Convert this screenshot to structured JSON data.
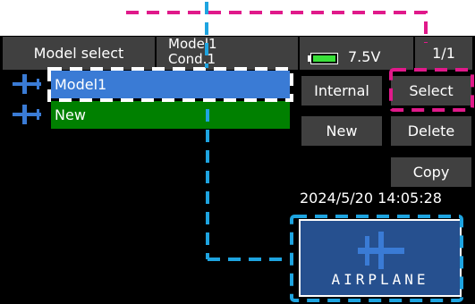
{
  "header": {
    "model_select": "Model select",
    "model_name": "Model1",
    "condition": "Cond.1",
    "battery_voltage": "7.5V",
    "page": "1/1"
  },
  "model_list": [
    {
      "label": "Model1",
      "icon": "airplane-icon",
      "row_color": "#3a7bd5"
    },
    {
      "label": "New",
      "icon": "airplane-icon",
      "row_color": "#008000"
    }
  ],
  "buttons": {
    "internal": "Internal",
    "select": "Select",
    "new": "New",
    "delete": "Delete",
    "copy": "Copy"
  },
  "datetime": "2024/5/20 14:05:28",
  "model_type": {
    "label": "AIRPLANE",
    "icon": "airplane-icon"
  },
  "colors": {
    "header_bg": "#404040",
    "selected_row": "#3a7bd5",
    "new_row": "#008000",
    "model_type_bg": "#26508f",
    "battery": "#39e039",
    "callout_magenta": "#e0198a",
    "callout_blue": "#1ea4e0"
  }
}
